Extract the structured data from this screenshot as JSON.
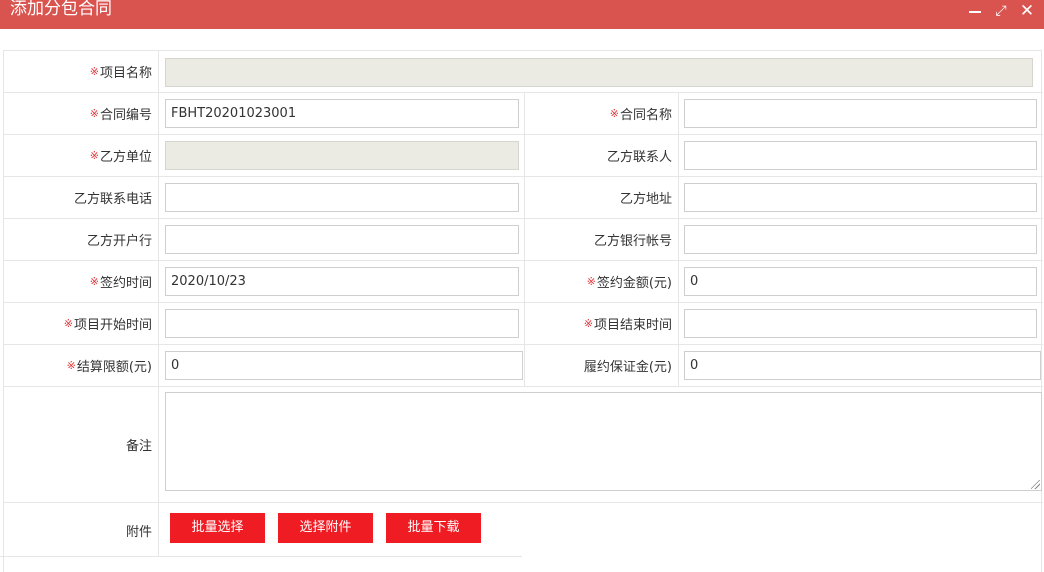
{
  "window": {
    "title": "添加分包合同",
    "min_icon": "minimize-icon",
    "max_icon": "maximize-icon",
    "close_icon": "close-icon"
  },
  "required_mark": "※",
  "fields": {
    "project_name": {
      "label": "项目名称",
      "value": ""
    },
    "contract_no": {
      "label": "合同编号",
      "value": "FBHT20201023001"
    },
    "contract_name": {
      "label": "合同名称",
      "value": ""
    },
    "partyb_unit": {
      "label": "乙方单位",
      "value": ""
    },
    "partyb_contact": {
      "label": "乙方联系人",
      "value": ""
    },
    "partyb_phone": {
      "label": "乙方联系电话",
      "value": ""
    },
    "partyb_address": {
      "label": "乙方地址",
      "value": ""
    },
    "partyb_bank": {
      "label": "乙方开户行",
      "value": ""
    },
    "partyb_account": {
      "label": "乙方银行帐号",
      "value": ""
    },
    "sign_date": {
      "label": "签约时间",
      "value": "2020/10/23"
    },
    "sign_amount": {
      "label": "签约金额(元)",
      "value": "0"
    },
    "start_date": {
      "label": "项目开始时间",
      "value": ""
    },
    "end_date": {
      "label": "项目结束时间",
      "value": ""
    },
    "settle_limit": {
      "label": "结算限额(元)",
      "value": "0"
    },
    "performance_bond": {
      "label": "履约保证金(元)",
      "value": "0"
    },
    "remarks": {
      "label": "备注",
      "value": ""
    },
    "attachments": {
      "label": "附件"
    }
  },
  "buttons": {
    "batch_select": "批量选择",
    "select_attachment": "选择附件",
    "batch_download": "批量下载"
  }
}
